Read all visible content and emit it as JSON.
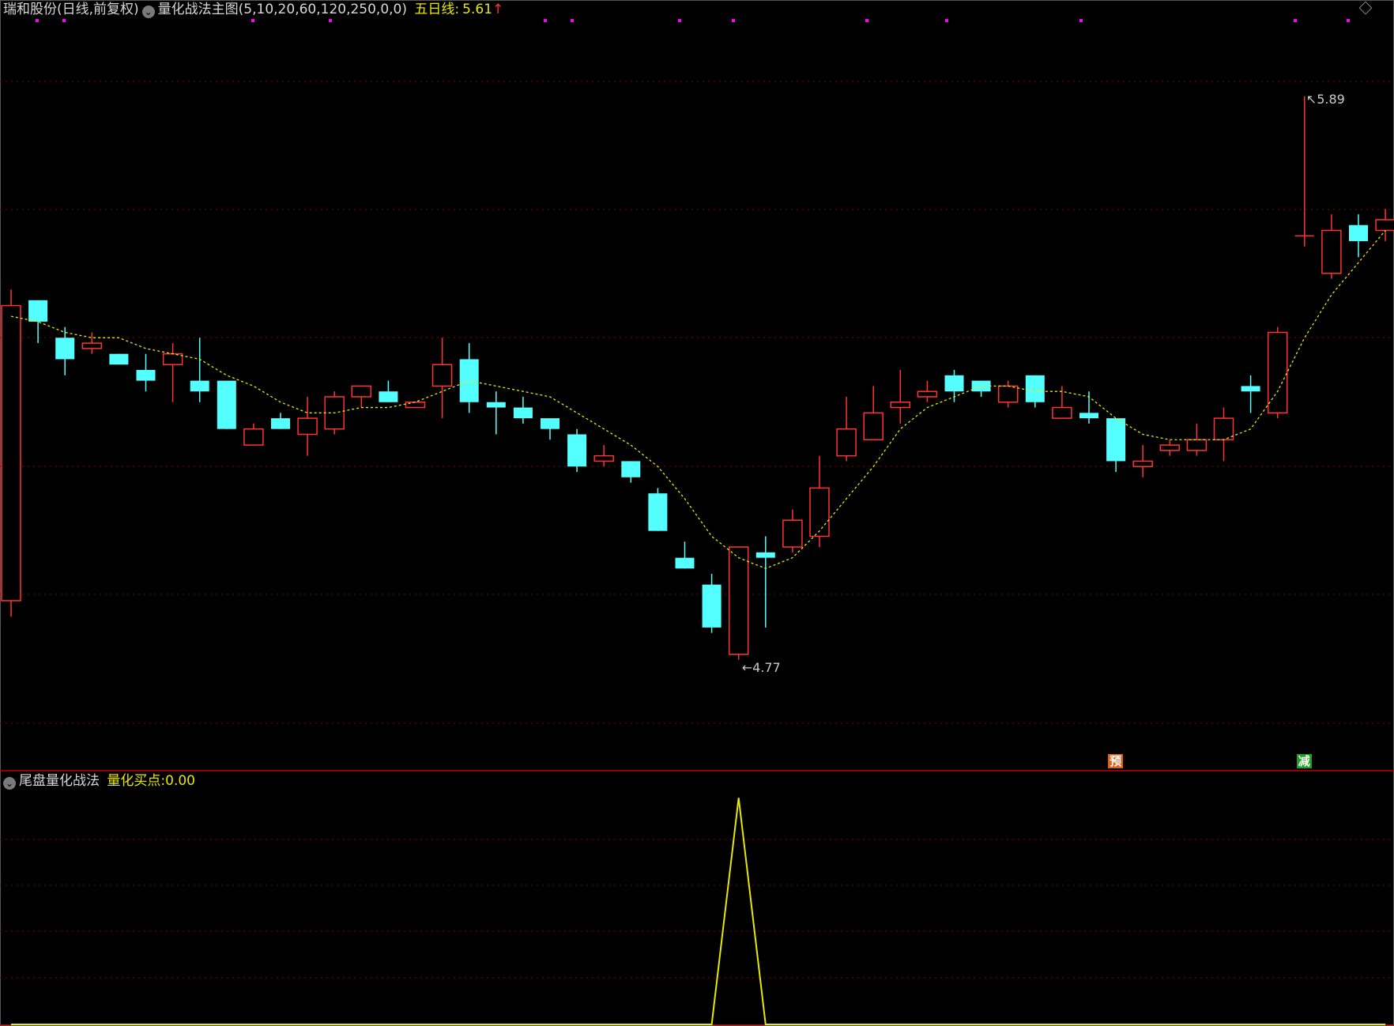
{
  "header": {
    "stock": "瑞和股份(日线,前复权)",
    "indicator": "量化战法主图(5,10,20,60,120,250,0,0)",
    "ma_label": "五日线:",
    "ma_value": "5.61",
    "ma_arrow": "↑"
  },
  "sub_header": {
    "indicator": "尾盘量化战法",
    "label": "量化买点:",
    "value": "0.00"
  },
  "annotations": {
    "high": "5.89",
    "low": "4.77"
  },
  "signals": [
    {
      "label": "预",
      "color": "#e06020",
      "index": 41
    },
    {
      "label": "减",
      "color": "#20a020",
      "index": 48
    }
  ],
  "colors": {
    "up": "#ff3333",
    "down": "#54ffff",
    "ma": "#e8e800",
    "grid": "#8a0000",
    "signal_line": "#e8e800",
    "dots": "#ff00ff"
  },
  "chart_data": [
    {
      "type": "candlestick",
      "title": "瑞和股份(日线,前复权)",
      "ylim": [
        4.67,
        6.04
      ],
      "series": [
        {
          "name": "candles",
          "ohlc": [
            [
              4.95,
              5.53,
              5.5,
              4.92
            ],
            [
              5.51,
              5.51,
              5.47,
              5.43
            ],
            [
              5.44,
              5.46,
              5.4,
              5.37
            ],
            [
              5.42,
              5.45,
              5.43,
              5.41
            ],
            [
              5.41,
              5.41,
              5.39,
              5.4
            ],
            [
              5.38,
              5.41,
              5.36,
              5.34
            ],
            [
              5.39,
              5.43,
              5.41,
              5.32
            ],
            [
              5.36,
              5.44,
              5.34,
              5.32
            ],
            [
              5.36,
              5.36,
              5.27,
              5.27
            ],
            [
              5.24,
              5.28,
              5.27,
              5.24
            ],
            [
              5.29,
              5.3,
              5.27,
              5.27
            ],
            [
              5.26,
              5.33,
              5.29,
              5.22
            ],
            [
              5.27,
              5.34,
              5.33,
              5.26
            ],
            [
              5.33,
              5.35,
              5.35,
              5.31
            ],
            [
              5.34,
              5.36,
              5.32,
              5.32
            ],
            [
              5.31,
              5.32,
              5.32,
              5.32
            ],
            [
              5.35,
              5.44,
              5.39,
              5.29
            ],
            [
              5.4,
              5.43,
              5.32,
              5.3
            ],
            [
              5.32,
              5.34,
              5.31,
              5.26
            ],
            [
              5.31,
              5.33,
              5.29,
              5.28
            ],
            [
              5.29,
              5.29,
              5.27,
              5.25
            ],
            [
              5.26,
              5.27,
              5.2,
              5.19
            ],
            [
              5.21,
              5.24,
              5.22,
              5.2
            ],
            [
              5.21,
              5.21,
              5.18,
              5.17
            ],
            [
              5.15,
              5.16,
              5.08,
              5.08
            ],
            [
              5.03,
              5.06,
              5.01,
              5.01
            ],
            [
              4.98,
              5.0,
              4.9,
              4.89
            ],
            [
              4.85,
              5.02,
              5.05,
              4.84
            ],
            [
              5.04,
              5.07,
              5.03,
              4.9
            ],
            [
              5.05,
              5.12,
              5.1,
              5.04
            ],
            [
              5.07,
              5.22,
              5.16,
              5.05
            ],
            [
              5.22,
              5.33,
              5.27,
              5.21
            ],
            [
              5.25,
              5.35,
              5.3,
              5.25
            ],
            [
              5.31,
              5.38,
              5.32,
              5.28
            ],
            [
              5.33,
              5.36,
              5.34,
              5.32
            ],
            [
              5.37,
              5.38,
              5.34,
              5.32
            ],
            [
              5.36,
              5.36,
              5.34,
              5.33
            ],
            [
              5.32,
              5.36,
              5.35,
              5.31
            ],
            [
              5.37,
              5.37,
              5.32,
              5.31
            ],
            [
              5.29,
              5.35,
              5.31,
              5.29
            ],
            [
              5.3,
              5.34,
              5.29,
              5.28
            ],
            [
              5.29,
              5.29,
              5.21,
              5.19
            ],
            [
              5.2,
              5.24,
              5.21,
              5.18
            ],
            [
              5.23,
              5.25,
              5.24,
              5.22
            ],
            [
              5.23,
              5.28,
              5.25,
              5.22
            ],
            [
              5.25,
              5.31,
              5.29,
              5.21
            ],
            [
              5.35,
              5.37,
              5.34,
              5.3
            ],
            [
              5.3,
              5.46,
              5.45,
              5.29
            ],
            [
              5.63,
              5.89,
              5.63,
              5.61
            ],
            [
              5.56,
              5.67,
              5.64,
              5.55
            ],
            [
              5.65,
              5.67,
              5.62,
              5.59
            ],
            [
              5.64,
              5.68,
              5.66,
              5.62
            ]
          ]
        },
        {
          "name": "五日线",
          "values": [
            5.48,
            5.47,
            5.45,
            5.44,
            5.44,
            5.42,
            5.41,
            5.4,
            5.37,
            5.35,
            5.32,
            5.3,
            5.3,
            5.31,
            5.31,
            5.32,
            5.34,
            5.36,
            5.35,
            5.34,
            5.33,
            5.3,
            5.27,
            5.24,
            5.2,
            5.14,
            5.07,
            5.03,
            5.01,
            5.03,
            5.08,
            5.14,
            5.2,
            5.27,
            5.31,
            5.33,
            5.35,
            5.35,
            5.34,
            5.34,
            5.33,
            5.29,
            5.26,
            5.25,
            5.25,
            5.25,
            5.27,
            5.34,
            5.44,
            5.52,
            5.58,
            5.64
          ]
        }
      ]
    },
    {
      "type": "line",
      "title": "尾盘量化战法",
      "ylim": [
        0,
        1.05
      ],
      "series": [
        {
          "name": "量化买点",
          "values": [
            0,
            0,
            0,
            0,
            0,
            0,
            0,
            0,
            0,
            0,
            0,
            0,
            0,
            0,
            0,
            0,
            0,
            0,
            0,
            0,
            0,
            0,
            0,
            0,
            0,
            0,
            0,
            1,
            0,
            0,
            0,
            0,
            0,
            0,
            0,
            0,
            0,
            0,
            0,
            0,
            0,
            0,
            0,
            0,
            0,
            0,
            0,
            0,
            0,
            0,
            0,
            0
          ]
        }
      ]
    }
  ]
}
